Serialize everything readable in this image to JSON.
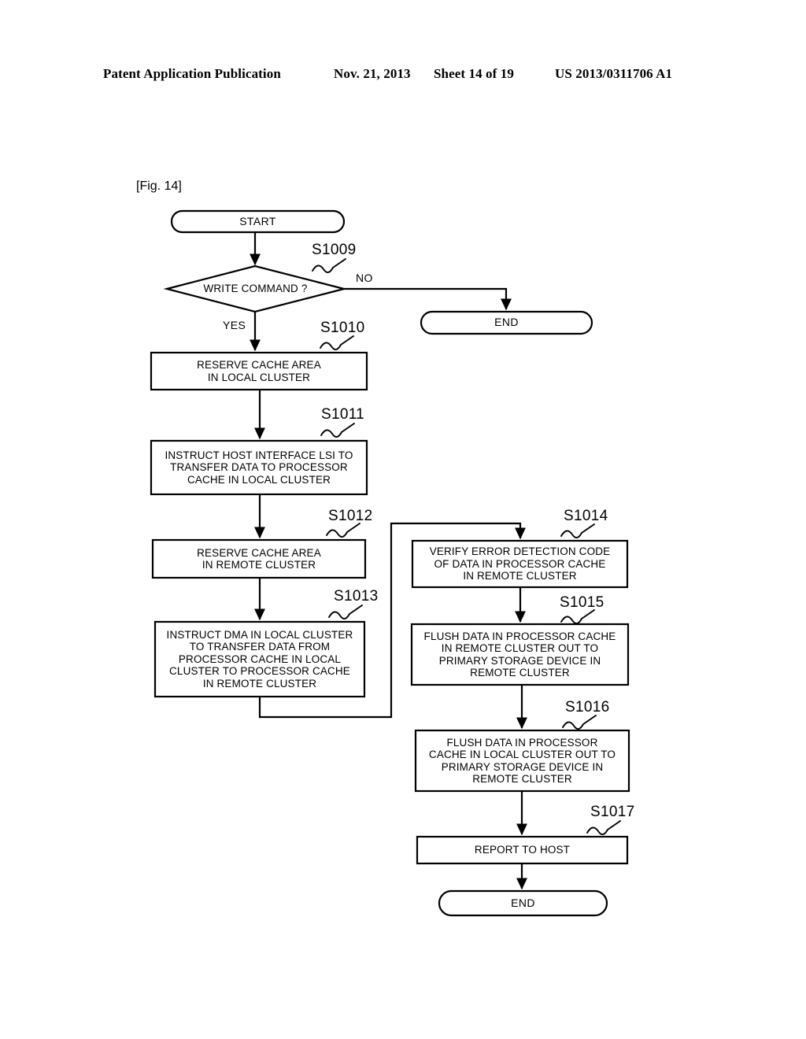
{
  "header": {
    "publication": "Patent Application Publication",
    "date": "Nov. 21, 2013",
    "sheet": "Sheet 14 of 19",
    "patent_number": "US 2013/0311706 A1"
  },
  "figure": {
    "label": "[Fig. 14]"
  },
  "diagram_data": {
    "type": "flowchart",
    "title": "[Fig. 14]",
    "nodes": [
      {
        "id": "start",
        "shape": "terminal",
        "text": "START"
      },
      {
        "id": "s1009",
        "shape": "decision",
        "step": "S1009",
        "text": "WRITE COMMAND ?"
      },
      {
        "id": "end1",
        "shape": "terminal",
        "text": "END"
      },
      {
        "id": "s1010",
        "shape": "process",
        "step": "S1010",
        "text": "RESERVE CACHE AREA\nIN LOCAL CLUSTER"
      },
      {
        "id": "s1011",
        "shape": "process",
        "step": "S1011",
        "text": "INSTRUCT HOST INTERFACE LSI TO\nTRANSFER DATA TO PROCESSOR\nCACHE  IN LOCAL CLUSTER"
      },
      {
        "id": "s1012",
        "shape": "process",
        "step": "S1012",
        "text": "RESERVE CACHE AREA\nIN REMOTE CLUSTER"
      },
      {
        "id": "s1013",
        "shape": "process",
        "step": "S1013",
        "text": "INSTRUCT DMA IN LOCAL CLUSTER\nTO TRANSFER DATA FROM\nPROCESSOR CACHE IN LOCAL\nCLUSTER TO PROCESSOR CACHE\nIN REMOTE CLUSTER"
      },
      {
        "id": "s1014",
        "shape": "process",
        "step": "S1014",
        "text": "VERIFY ERROR DETECTION CODE\nOF DATA IN PROCESSOR CACHE\nIN REMOTE CLUSTER"
      },
      {
        "id": "s1015",
        "shape": "process",
        "step": "S1015",
        "text": "FLUSH DATA IN PROCESSOR CACHE\nIN REMOTE CLUSTER OUT TO\nPRIMARY STORAGE DEVICE IN\nREMOTE CLUSTER"
      },
      {
        "id": "s1016",
        "shape": "process",
        "step": "S1016",
        "text": "FLUSH DATA IN PROCESSOR\nCACHE IN LOCAL CLUSTER OUT TO\nPRIMARY STORAGE DEVICE IN\nREMOTE CLUSTER"
      },
      {
        "id": "s1017",
        "shape": "process",
        "step": "S1017",
        "text": "REPORT TO HOST"
      },
      {
        "id": "end2",
        "shape": "terminal",
        "text": "END"
      }
    ],
    "edges": [
      {
        "from": "start",
        "to": "s1009",
        "label": ""
      },
      {
        "from": "s1009",
        "to": "end1",
        "label": "NO"
      },
      {
        "from": "s1009",
        "to": "s1010",
        "label": "YES"
      },
      {
        "from": "s1010",
        "to": "s1011",
        "label": ""
      },
      {
        "from": "s1011",
        "to": "s1012",
        "label": ""
      },
      {
        "from": "s1012",
        "to": "s1013",
        "label": ""
      },
      {
        "from": "s1013",
        "to": "s1014",
        "label": ""
      },
      {
        "from": "s1014",
        "to": "s1015",
        "label": ""
      },
      {
        "from": "s1015",
        "to": "s1016",
        "label": ""
      },
      {
        "from": "s1016",
        "to": "s1017",
        "label": ""
      },
      {
        "from": "s1017",
        "to": "end2",
        "label": ""
      }
    ],
    "branch_labels": {
      "no": "NO",
      "yes": "YES"
    },
    "line_color": "#000000",
    "fill_color": "#ffffff"
  }
}
